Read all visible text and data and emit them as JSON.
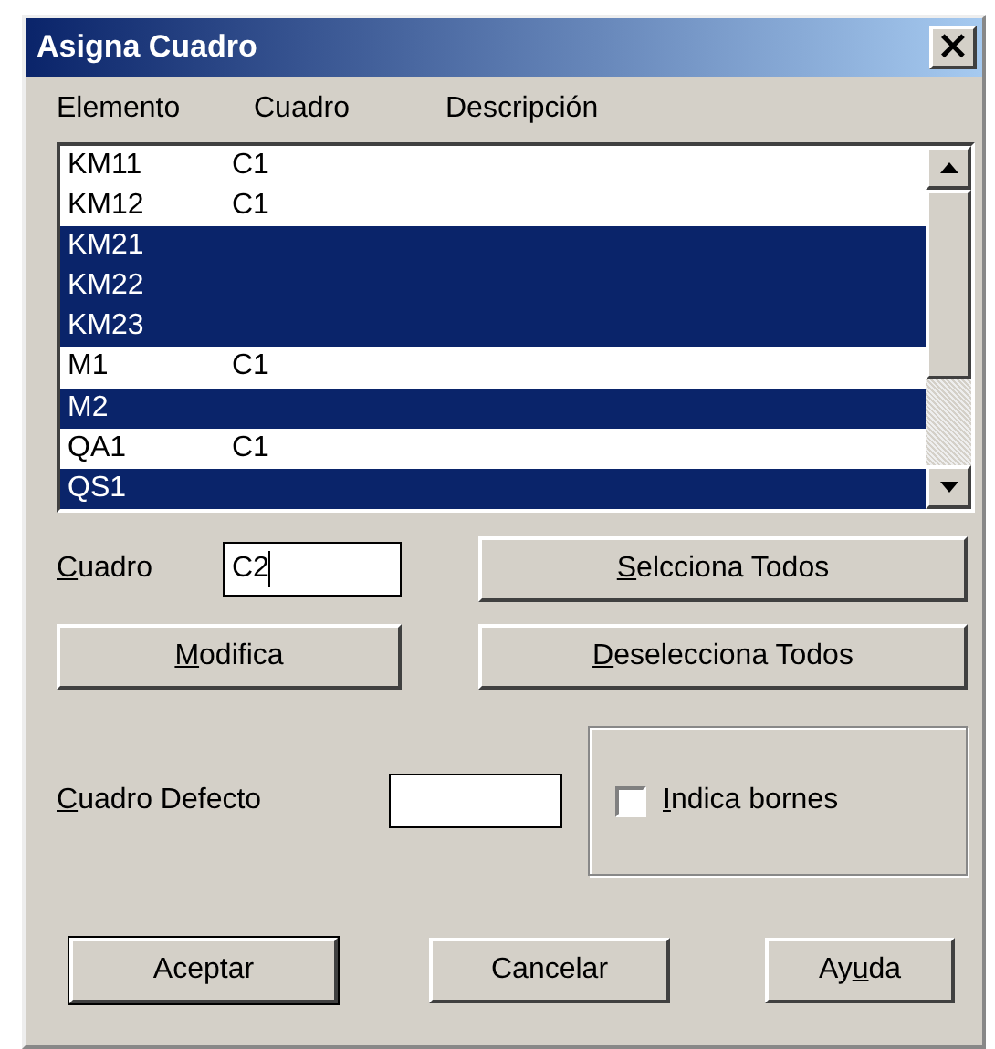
{
  "window": {
    "title": "Asigna Cuadro",
    "close": "×"
  },
  "list": {
    "columns": [
      "Elemento",
      "Cuadro",
      "Descripción"
    ],
    "rows": [
      {
        "elemento": "KM11",
        "cuadro": "C1",
        "selected": false
      },
      {
        "elemento": "KM12",
        "cuadro": "C1",
        "selected": false
      },
      {
        "elemento": "KM21",
        "selected": true
      },
      {
        "elemento": "KM22",
        "selected": true
      },
      {
        "elemento": "KM23",
        "selected": true
      },
      {
        "elemento": "M1",
        "cuadro": "C1",
        "selected": false
      },
      {
        "elemento": "M2",
        "selected": true
      },
      {
        "elemento": "QA1",
        "cuadro": "C1",
        "selected": false
      },
      {
        "elemento": "QS1",
        "selected": true
      }
    ]
  },
  "cuadro_field": {
    "label": {
      "key": "C",
      "after": "uadro"
    },
    "value": "C2"
  },
  "select_all_button": {
    "label": {
      "key": "S",
      "after": "elcciona Todos"
    }
  },
  "modify_button": {
    "label": {
      "key": "M",
      "after": "odifica"
    }
  },
  "deselect_all_button": {
    "label": {
      "key": "D",
      "after": "eselecciona Todos"
    }
  },
  "default_field": {
    "label": {
      "key": "C",
      "after": "uadro Defecto"
    }
  },
  "terminals_checkbox": {
    "label": {
      "key": "I",
      "after": "ndica bornes"
    },
    "checked": false
  },
  "buttons": [
    {
      "label": {
        "before": "Aceptar"
      },
      "default": true
    },
    {
      "label": {
        "before": "Cancelar"
      },
      "default": false
    },
    {
      "label": {
        "before": "Ay",
        "key": "u",
        "after": "da"
      },
      "default": false
    }
  ]
}
